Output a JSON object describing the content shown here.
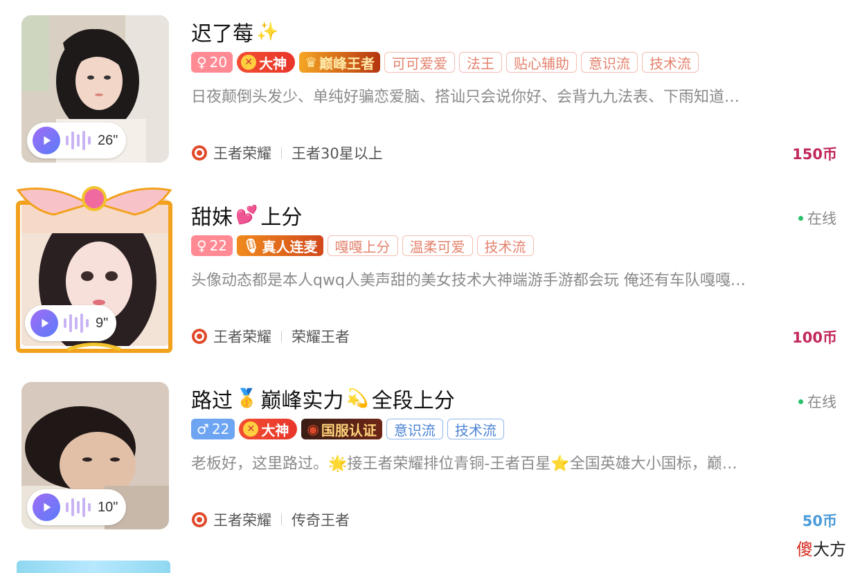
{
  "listings": [
    {
      "name": "迟了莓",
      "name_emoji": "✨",
      "online": "",
      "gender": "♀",
      "age": "20",
      "badges": [
        "大神",
        "巅峰王者"
      ],
      "tags": [
        "可可爱爱",
        "法王",
        "贴心辅助",
        "意识流",
        "技术流"
      ],
      "description": "日夜颠倒头发少、单纯好骗恋爱脑、搭讪只会说你好、会背九九法表、下雨知道…",
      "voice_duration": "26\"",
      "game": "王者荣耀",
      "rank": "王者30星以上",
      "price": "150币",
      "price_color": "#c2275a"
    },
    {
      "name": "甜妹",
      "name_emoji": "💕",
      "name_suffix": "上分",
      "online": "在线",
      "gender": "♀",
      "age": "22",
      "badges": [
        "真人连麦"
      ],
      "tags": [
        "嘎嘎上分",
        "温柔可爱",
        "技术流"
      ],
      "description": "头像动态都是本人qwq人美声甜的美女技术大神端游手游都会玩 俺还有车队嘎嘎…",
      "voice_duration": "9\"",
      "game": "王者荣耀",
      "rank": "荣耀王者",
      "price": "100币",
      "price_color": "#c2275a"
    },
    {
      "name": "路过",
      "name_emoji": "🥇",
      "name_mid": "巅峰实力",
      "name_emoji2": "💫",
      "name_suffix": "全段上分",
      "online": "在线",
      "gender": "♂",
      "age": "22",
      "badges": [
        "大神",
        "国服认证"
      ],
      "tags": [
        "意识流",
        "技术流"
      ],
      "description": "老板好，这里路过。🌟接王者荣耀排位青铜-王者百星⭐全国英雄大小国标，巅…",
      "voice_duration": "10\"",
      "game": "王者荣耀",
      "rank": "传奇王者",
      "price": "50币",
      "price_color": "#4a9ad8"
    }
  ],
  "watermark": {
    "part1": "傻",
    "part2": "大方"
  },
  "colors": {
    "online_dot": "#29c26a",
    "tag_border": "#f5bdb0",
    "tag_text": "#e4826d",
    "blue_tag": "#4b83d6"
  },
  "icons": [
    "play-icon",
    "voice-wave-icon",
    "game-logo-icon",
    "sparkle-icon",
    "wings-frame"
  ]
}
